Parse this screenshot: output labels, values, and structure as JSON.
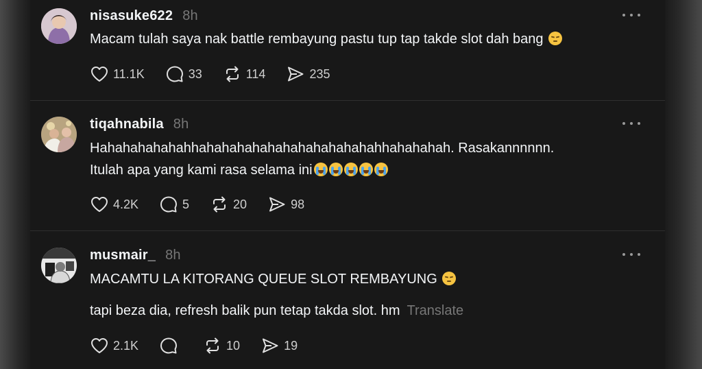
{
  "posts": [
    {
      "username": "nisasuke622",
      "time": "8h",
      "lines": [
        "Macam tulah saya nak battle rembayung pastu tup tap takde slot dah bang"
      ],
      "emojis": [
        "pensive"
      ],
      "likes": "11.1K",
      "replies": "33",
      "reposts": "114",
      "shares": "235"
    },
    {
      "username": "tiqahnabila",
      "time": "8h",
      "lines": [
        "Hahahahahahahhahahahahahahahahahahahahhahahahah. Rasakannnnnn.",
        "Itulah apa yang kami rasa selama ini"
      ],
      "emojis": [
        "cry",
        "cry",
        "cry",
        "cry",
        "cry"
      ],
      "likes": "4.2K",
      "replies": "5",
      "reposts": "20",
      "shares": "98"
    },
    {
      "username": "musmair_",
      "time": "8h",
      "lines": [
        "MACAMTU LA KITORANG QUEUE SLOT REMBAYUNG",
        "tapi beza dia, refresh balik pun tetap takda slot. hm"
      ],
      "emojis": [
        "pensive"
      ],
      "translate": "Translate",
      "likes": "2.1K",
      "replies": "",
      "reposts": "10",
      "shares": "19"
    }
  ],
  "icons": {
    "like": "heart-icon",
    "reply": "comment-icon",
    "repost": "repost-icon",
    "share": "send-icon",
    "more": "more-dots-icon"
  },
  "colors": {
    "background": "#181818",
    "text": "#f3f5f7",
    "muted": "#777777"
  }
}
